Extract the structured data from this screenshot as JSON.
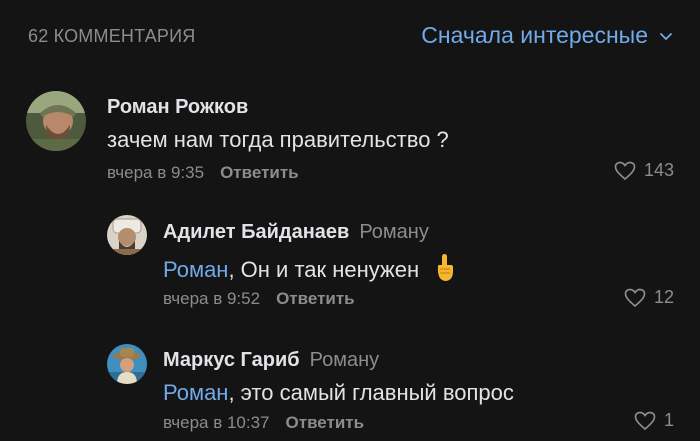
{
  "header": {
    "count_label": "62 КОММЕНТАРИЯ",
    "sort_label": "Сначала интересные"
  },
  "comments": [
    {
      "author": "Роман Рожков",
      "text": "зачем нам тогда правительство ?",
      "time": "вчера в 9:35",
      "reply_label": "Ответить",
      "likes": "143"
    },
    {
      "author": "Адилет Байданаев",
      "reply_to": "Роману",
      "mention": "Роман",
      "text": ", Он и так ненужен",
      "time": "вчера в 9:52",
      "reply_label": "Ответить",
      "likes": "12"
    },
    {
      "author": "Маркус Гариб",
      "reply_to": "Роману",
      "mention": "Роман",
      "text": ", это самый главный вопрос",
      "time": "вчера в 10:37",
      "reply_label": "Ответить",
      "likes": "1"
    }
  ],
  "colors": {
    "background": "#141414",
    "accent": "#71aaeb",
    "secondary_text": "#8a8c90",
    "primary_text": "#e1e3e6"
  },
  "icons": {
    "sort": "chevron-down-icon",
    "like": "heart-outline-icon",
    "emoji": "pointing-up-emoji"
  }
}
